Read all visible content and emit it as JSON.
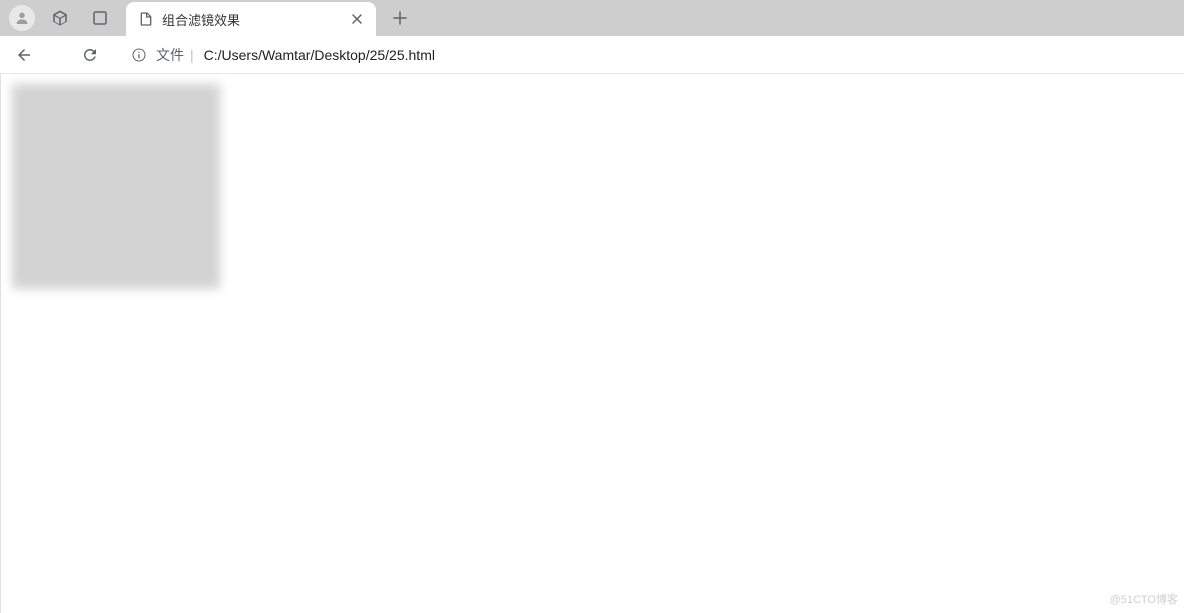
{
  "browser": {
    "tab": {
      "title": "组合滤镜效果"
    },
    "address": {
      "file_label": "文件",
      "path": "C:/Users/Wamtar/Desktop/25/25.html"
    }
  },
  "watermark": "@51CTO博客"
}
